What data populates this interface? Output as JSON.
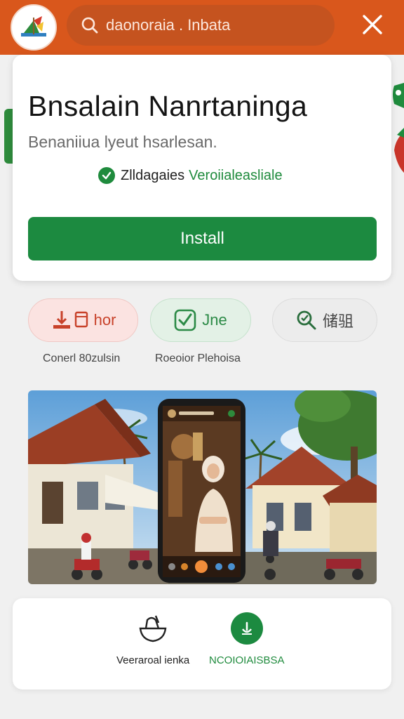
{
  "search": {
    "text": "daonoraia . Inbata"
  },
  "header": {
    "title": "Bnsalain Nanrtaninga",
    "subtitle": "Benaniiua lyeut hsarlesan.",
    "badge_text": "Zlldagaies",
    "badge_verified": "Veroiialeasliale",
    "install_label": "Install"
  },
  "chips": [
    {
      "label": "hor",
      "caption": "Conerl 80zulsin",
      "icon": "download-icon",
      "color": "#c8422a"
    },
    {
      "label": "Jne",
      "caption": "Roeoior Plehoisa",
      "icon": "check-square-icon",
      "color": "#2b8a46"
    },
    {
      "label": "储驵",
      "caption": "",
      "icon": "search-check-icon",
      "color": "#2a6e3d"
    }
  ],
  "bottom": {
    "left_label": "Veeraroal ienka",
    "right_label": "NCOIOIAISBSA"
  },
  "colors": {
    "topbar": "#d9571c",
    "accent_green": "#1c8a40",
    "chip_red": "#c8422a"
  }
}
